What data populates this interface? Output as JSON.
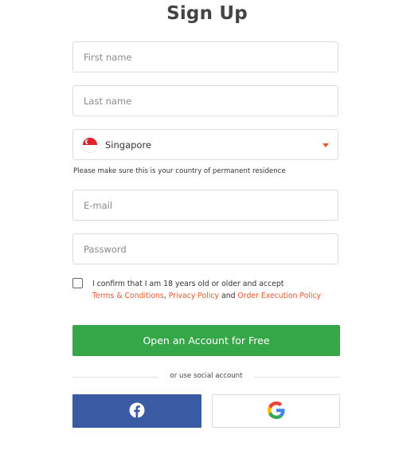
{
  "header": {
    "title": "Sign Up"
  },
  "form": {
    "first_name": {
      "placeholder": "First name",
      "value": ""
    },
    "last_name": {
      "placeholder": "Last name",
      "value": ""
    },
    "country": {
      "selected": "Singapore",
      "flag_icon": "singapore-flag-icon"
    },
    "country_hint": "Please make sure this is your country of permanent residence",
    "email": {
      "placeholder": "E-mail",
      "value": ""
    },
    "password": {
      "placeholder": "Password",
      "value": ""
    },
    "consent": {
      "checked": false,
      "text_prefix": "I confirm that I am 18 years old or older and accept",
      "terms_link": "Terms & Conditions",
      "separator_comma": ",",
      "privacy_link": "Privacy Policy",
      "and_text": "and",
      "order_link": "Order Execution Policy"
    },
    "submit_label": "Open an Account for Free"
  },
  "social": {
    "divider_text": "or use social account",
    "facebook_icon": "facebook-icon",
    "google_icon": "google-icon"
  },
  "colors": {
    "accent_green": "#36a748",
    "link_orange": "#e8572a",
    "facebook_blue": "#3b5aa4"
  }
}
